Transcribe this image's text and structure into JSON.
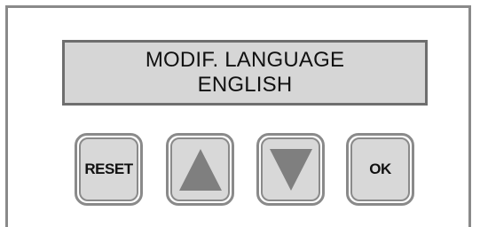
{
  "display": {
    "line1": "MODIF. LANGUAGE",
    "line2": "ENGLISH"
  },
  "buttons": {
    "reset_label": "RESET",
    "up_icon": "up-triangle-icon",
    "down_icon": "down-triangle-icon",
    "ok_label": "OK"
  },
  "colors": {
    "lcd_background": "#d6d6d6",
    "button_face": "#d8d8d8",
    "icon_fill": "#7f7f7f",
    "border": "#8a8a8a"
  }
}
